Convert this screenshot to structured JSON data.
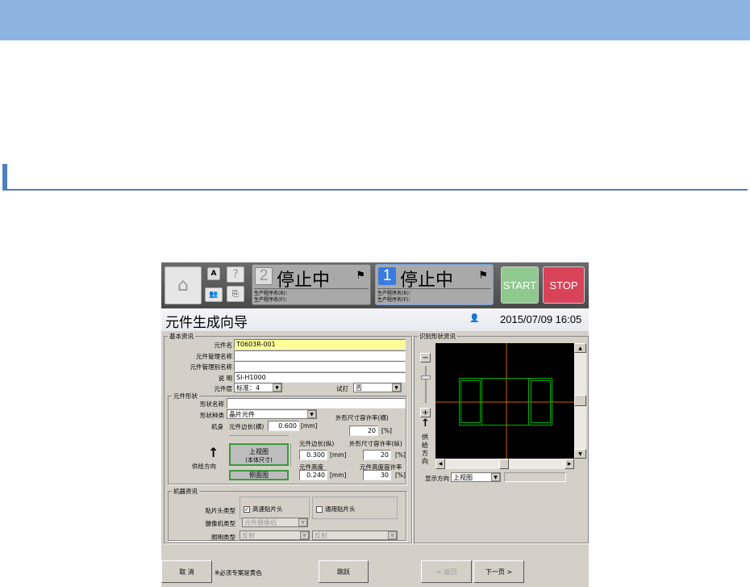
{
  "toolbar": {
    "lane2": {
      "number": "2",
      "status": "停止中",
      "prog_r": "生产程序名(R)：",
      "prog_f": "生产程序名(F)："
    },
    "lane1": {
      "number": "1",
      "status": "停止中",
      "prog_r": "生产程序名(R)：",
      "prog_f": "生产程序名(F)："
    },
    "start": "START",
    "stop": "STOP",
    "a_label": "A",
    "help": "?"
  },
  "title": "元件生成向导",
  "datetime": "2015/07/09 16:05",
  "basic": {
    "group": "基本资讯",
    "part_name_label": "元件名",
    "part_name": "T0603R-001",
    "mgmt_name_label": "元件管理名称",
    "mgmt_alias_label": "元件管理别名称",
    "desc_label": "说 明",
    "desc": "SI-H1000",
    "layer_label": "元件层",
    "layer": "标准：4",
    "trial_label": "试打",
    "trial": "否"
  },
  "shape": {
    "group": "元件形状",
    "shape_name_label": "形状名称",
    "shape_type_label": "形状种类",
    "shape_type": "晶片元件",
    "body_label": "机身",
    "len_x_label": "元件边长(横)",
    "len_x": "0.600",
    "mm": "[mm]",
    "pct": "[%]",
    "tol_x_label": "外形尺寸容许率(横)",
    "tol_x": "20",
    "top_view": "上视图",
    "top_view_sub": "(本体尺寸)",
    "side_view": "侧面图",
    "feed_dir": "供给方向",
    "len_y_label": "元件边长(纵)",
    "len_y": "0.300",
    "tol_y_label": "外形尺寸容许率(纵)",
    "tol_y": "20",
    "height_label": "元件高度",
    "height": "0.240",
    "tol_h_label": "元件高度容许率",
    "tol_h": "30"
  },
  "machine": {
    "group": "机器资讯",
    "head_label": "贴片头类型",
    "head_hs": "高速贴片头",
    "head_gen": "通用贴片头",
    "camera_label": "摄像机类型",
    "camera": "元件摄像机",
    "light_label": "照明类型",
    "light1": "反射",
    "light2": "反射"
  },
  "recog": {
    "group": "识别形状资讯",
    "feed_dir": [
      "供",
      "给",
      "方",
      "向"
    ],
    "display_dir_label": "显示方向",
    "display_dir": "上视图"
  },
  "footer": {
    "cancel": "取 消",
    "note": "※必须专案是黄色",
    "skip": "跳跃",
    "back": "< 返回",
    "next": "下一页 >"
  },
  "colors": {
    "banner": "#8db3e2",
    "accent": "#4f81bd",
    "start": "#8fc98f",
    "stop": "#d9435a",
    "green_outline": "#00cc00",
    "crosshair": "#cc6600"
  }
}
